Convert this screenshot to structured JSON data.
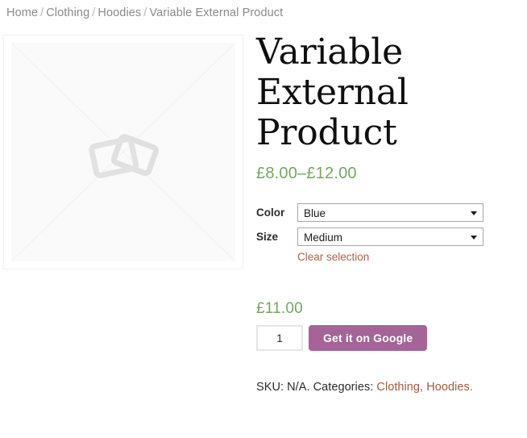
{
  "breadcrumb": {
    "separator": "/",
    "items": [
      {
        "label": "Home"
      },
      {
        "label": "Clothing"
      },
      {
        "label": "Hoodies"
      },
      {
        "label": "Variable External Product"
      }
    ]
  },
  "gallery": {
    "placeholder_icon": "image-placeholder-icon",
    "alt": "Awaiting product image"
  },
  "product": {
    "title": "Variable External Product",
    "price_range": "£8.00–£12.00",
    "variation_price": "£11.00",
    "colors": {
      "price_green": "#77a464",
      "link_brown": "#a56444",
      "button_purple": "#a46497"
    }
  },
  "variations": {
    "attributes": [
      {
        "label": "Color",
        "selected": "Blue"
      },
      {
        "label": "Size",
        "selected": "Medium"
      }
    ],
    "reset_label": "Clear selection"
  },
  "cart": {
    "quantity": "1",
    "quantity_placeholder": "1",
    "buy_label": "Get it on Google"
  },
  "meta": {
    "sku_text": "SKU: N/A.",
    "categories_label": "Categories:",
    "categories": [
      {
        "label": "Clothing",
        "suffix": ","
      },
      {
        "label": "Hoodies",
        "suffix": "."
      }
    ]
  }
}
